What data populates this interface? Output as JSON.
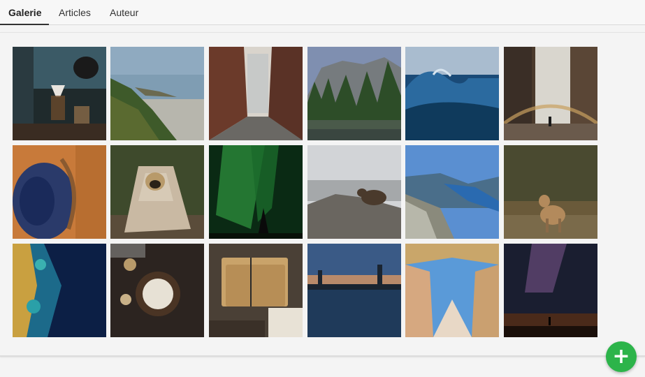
{
  "tabs": [
    {
      "label": "Galerie",
      "active": true
    },
    {
      "label": "Articles",
      "active": false
    },
    {
      "label": "Auteur",
      "active": false
    }
  ],
  "gallery": {
    "photos": [
      {
        "subject": "coffee-brewing"
      },
      {
        "subject": "coastal-cliffs-sunset"
      },
      {
        "subject": "narrow-alley"
      },
      {
        "subject": "valley-cliffs-river"
      },
      {
        "subject": "ocean-wave"
      },
      {
        "subject": "waterfall-rainbow"
      },
      {
        "subject": "aerial-crater"
      },
      {
        "subject": "pug-in-blanket"
      },
      {
        "subject": "aurora-night-sky"
      },
      {
        "subject": "bear-snowy-ridge"
      },
      {
        "subject": "fjord-cliff-view"
      },
      {
        "subject": "fawn-in-forest"
      },
      {
        "subject": "aerial-ocean-coast"
      },
      {
        "subject": "dessert-on-table"
      },
      {
        "subject": "stack-of-letters"
      },
      {
        "subject": "city-skyline-water"
      },
      {
        "subject": "church-looking-up"
      },
      {
        "subject": "milky-way-silhouette"
      }
    ]
  },
  "add_button": {
    "icon": "plus-icon",
    "glyph": "+",
    "color": "#2cb44a"
  }
}
